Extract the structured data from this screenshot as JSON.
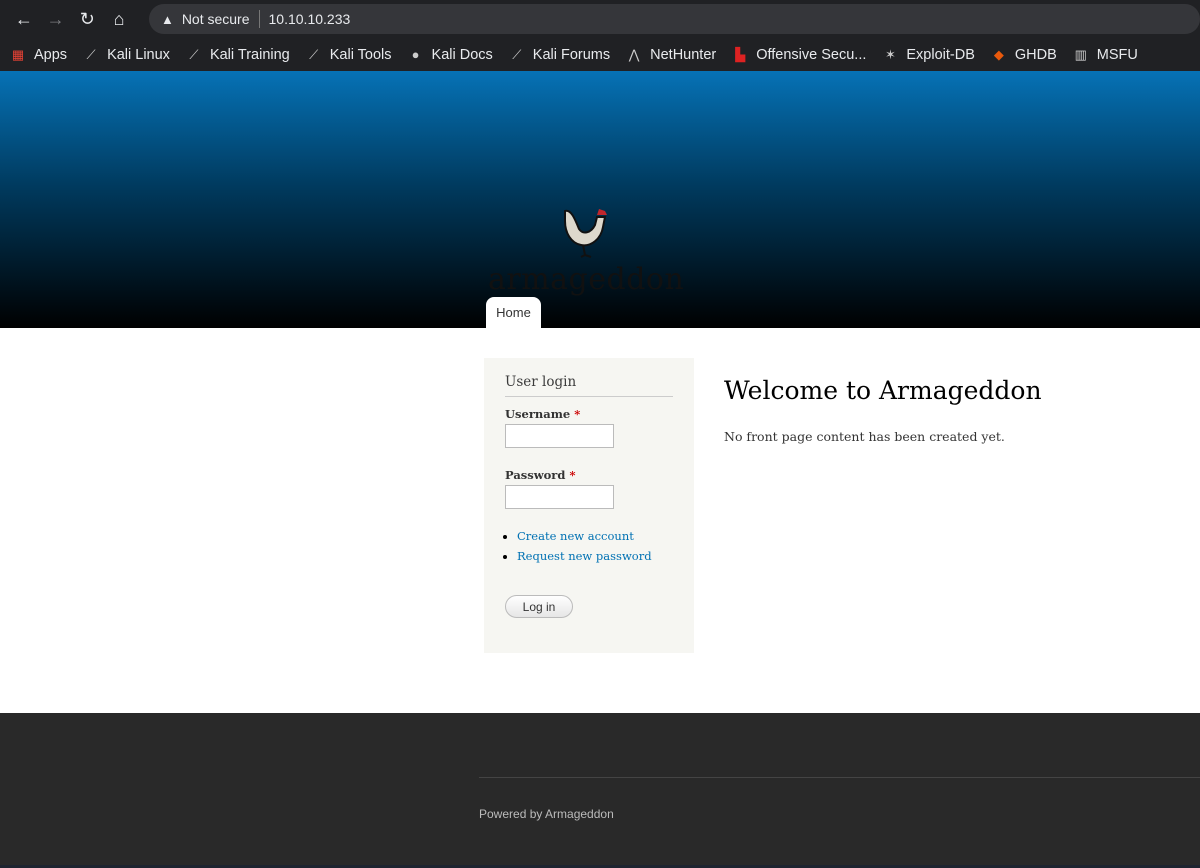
{
  "browser": {
    "security": "Not secure",
    "url": "10.10.10.233",
    "bookmarks": [
      {
        "label": "Apps",
        "icon": "apps-grid-icon"
      },
      {
        "label": "Kali Linux",
        "icon": "kali-dragon-icon"
      },
      {
        "label": "Kali Training",
        "icon": "kali-dragon-icon"
      },
      {
        "label": "Kali Tools",
        "icon": "kali-dragon-icon"
      },
      {
        "label": "Kali Docs",
        "icon": "globe-icon"
      },
      {
        "label": "Kali Forums",
        "icon": "kali-dragon-icon"
      },
      {
        "label": "NetHunter",
        "icon": "nethunter-icon"
      },
      {
        "label": "Offensive Secu...",
        "icon": "offsec-icon"
      },
      {
        "label": "Exploit-DB",
        "icon": "exploitdb-icon"
      },
      {
        "label": "GHDB",
        "icon": "ghdb-icon"
      },
      {
        "label": "MSFU",
        "icon": "msfu-icon"
      }
    ]
  },
  "site": {
    "name": "armageddon",
    "nav": {
      "home": "Home"
    }
  },
  "login": {
    "title": "User login",
    "username_label": "Username",
    "password_label": "Password",
    "required": "*",
    "username_value": "",
    "password_value": "",
    "links": [
      "Create new account",
      "Request new password"
    ],
    "submit": "Log in"
  },
  "main": {
    "title": "Welcome to Armageddon",
    "body": "No front page content has been created yet."
  },
  "footer": {
    "powered": "Powered by Armageddon"
  }
}
